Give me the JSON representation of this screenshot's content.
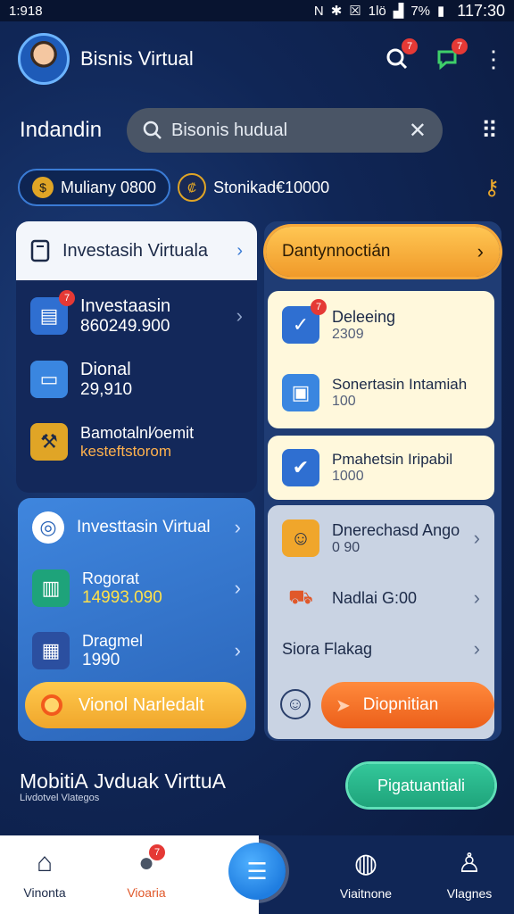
{
  "status": {
    "left": "1:918",
    "battery": "7%",
    "time": "117:30",
    "net": "1lö"
  },
  "header": {
    "title": "Bisnis Virtual",
    "notif_badge": "7",
    "chat_badge": "7"
  },
  "search": {
    "label": "Indandin",
    "value": "Bisonis hudual"
  },
  "chips": [
    {
      "label": "Muliany 0800"
    },
    {
      "label": "Stonikad€10000"
    }
  ],
  "left_card": {
    "header": "Investasih Virtuala",
    "items": [
      {
        "title": "Investaasin",
        "value": "860249.900",
        "badge": "7"
      },
      {
        "title": "Dional",
        "value": "29,910"
      },
      {
        "title": "Bamotalnl⁄oemit",
        "value": "kesteftstorom"
      }
    ]
  },
  "left_bottom": {
    "header": "Investtasin Virtual",
    "items": [
      {
        "title": "Rogorat",
        "value": "14993.090"
      },
      {
        "title": "Dragmel",
        "value": "1990"
      }
    ],
    "cta": "Vionol Narledalt"
  },
  "right": {
    "orange_bar": "Dantynnoctián",
    "cream1": [
      {
        "title": "Deleeing",
        "value": "2309",
        "badge": "7"
      },
      {
        "title": "Sonertasin Intamiah",
        "value": "100"
      }
    ],
    "cream2": {
      "title": "Pmahetsin Iripabil",
      "value": "1000"
    },
    "gray": [
      {
        "title": "Dnerechasd Ango",
        "value": "0 90"
      },
      {
        "title": "Nadlai G:00"
      },
      {
        "title": "Siora Flakag"
      }
    ],
    "cta": "Diopnitian"
  },
  "footer": {
    "title": "MobitiА Jvduak VirttuA",
    "subtitle": "Livdotvel Vlategos",
    "button": "Pigatuantiali"
  },
  "nav": [
    {
      "label": "Vinonta"
    },
    {
      "label": "Vioaria",
      "badge": "7"
    },
    {
      "label": "Viaitnone"
    },
    {
      "label": "Vlagnes"
    }
  ],
  "colors": {
    "accent": "#3a7bd5",
    "orange": "#f09a2a",
    "green": "#1fa47b",
    "badge": "#e53935"
  }
}
